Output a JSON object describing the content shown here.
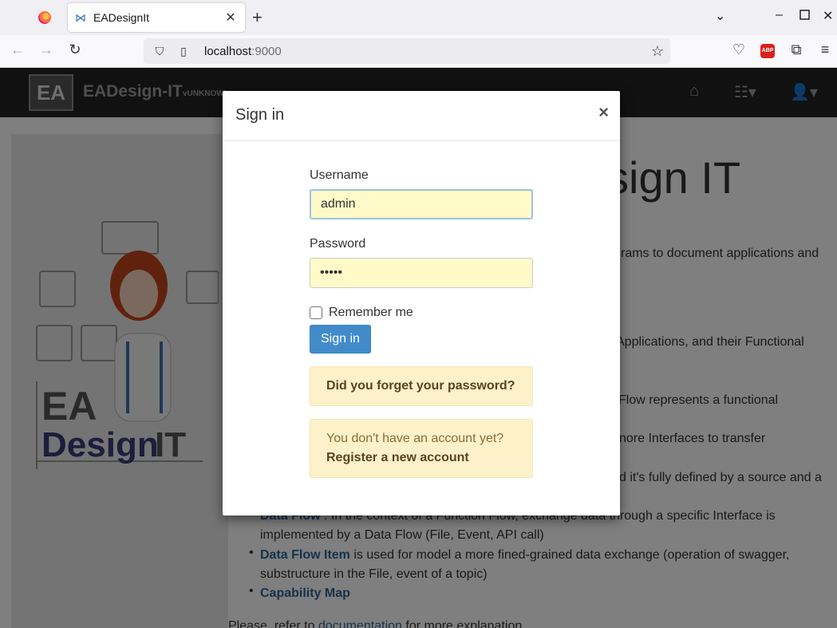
{
  "browser": {
    "tab_title": "EADesignIt",
    "url_host": "localhost",
    "url_port": ":9000",
    "abp_label": "ABP"
  },
  "app": {
    "logo_text": "EA",
    "brand": "EADesign-IT",
    "version": "vUNKNOWN"
  },
  "background": {
    "heading": "sign IT",
    "lines": [
      "rams to document applications and",
      "Applications, and their Functional",
      "Flow represents a functional",
      "nore Interfaces to transfer",
      "d it's fully defined by a source and a"
    ],
    "data_flow_link": "Data Flow",
    "data_flow_text": ": In the context of a Function Flow, exchange data through a specific Interface is",
    "data_flow_text2": "implemented by a Data Flow (File, Event, API call)",
    "data_flow_item_link": "Data Flow Item",
    "data_flow_item_text": "is used for model a more fined-grained data exchange (operation of swagger,",
    "data_flow_item_text2": "substructure in the File, event of a topic)",
    "capability_map_link": "Capability Map",
    "footer_prefix": "Please, refer to",
    "footer_link": "documentation",
    "footer_suffix": "for more explanation",
    "mascot_ea": "EA",
    "mascot_design": "Design",
    "mascot_it": "IT"
  },
  "modal": {
    "title": "Sign in",
    "close": "×",
    "username_label": "Username",
    "username_value": "admin",
    "password_label": "Password",
    "password_value": "•••••",
    "remember_label": "Remember me",
    "signin_button": "Sign in",
    "forgot_password": "Did you forget your password?",
    "no_account": "You don't have an account yet?",
    "register": "Register a new account"
  }
}
